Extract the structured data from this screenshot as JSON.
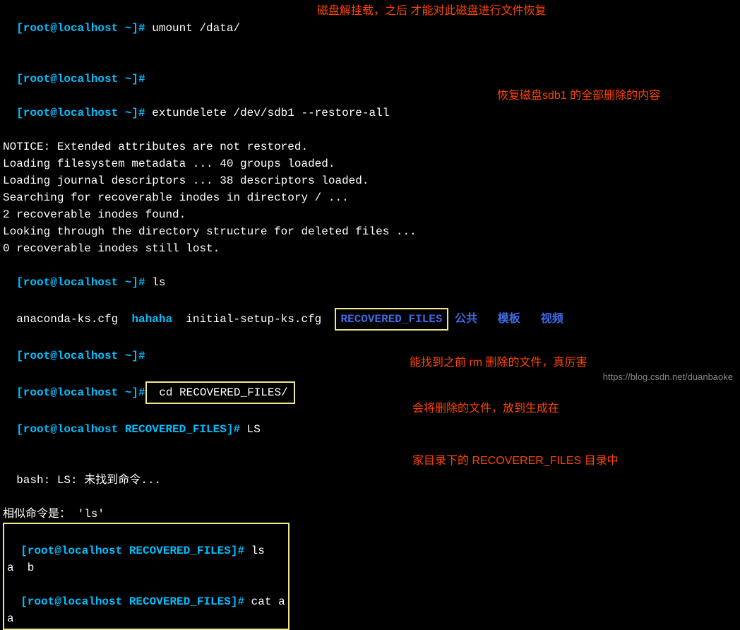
{
  "lines": {
    "l1": {
      "prompt": "[root@localhost ~]#",
      "cmd": " umount /data/"
    },
    "l2": {
      "prompt": "[root@localhost ~]#"
    },
    "l3": {
      "prompt": "[root@localhost ~]#",
      "cmd": " extundelete /dev/sdb1 --restore-all"
    },
    "l4": "NOTICE: Extended attributes are not restored.",
    "l5": "Loading filesystem metadata ... 40 groups loaded.",
    "l6": "Loading journal descriptors ... 38 descriptors loaded.",
    "l7": "Searching for recoverable inodes in directory / ...",
    "l8": "2 recoverable inodes found.",
    "l9": "Looking through the directory structure for deleted files ...",
    "l10": "0 recoverable inodes still lost.",
    "l11": {
      "prompt": "[root@localhost ~]#",
      "cmd": " ls"
    },
    "l12": {
      "f1": "anaconda-ks.cfg  ",
      "f2": "hahaha",
      "f3": "  initial-setup-ks.cfg  ",
      "f4": "RECOVERED_FILES",
      "f5": " 公共",
      "f6": "   模板",
      "f7": "   视频"
    },
    "l13": {
      "prompt": "[root@localhost ~]#"
    },
    "l14": {
      "prompt": "[root@localhost ~]#",
      "cmd": " cd RECOVERED_FILES/"
    },
    "l15": {
      "prompt": "[root@localhost RECOVERED_FILES]#",
      "cmd": " LS"
    },
    "l16": "bash: LS: 未找到命令...",
    "l17": "相似命令是： 'ls'",
    "l18": {
      "prompt": "[root@localhost RECOVERED_FILES]#",
      "cmd": " ls"
    },
    "l19": "a  b",
    "l20": {
      "prompt": "[root@localhost RECOVERED_FILES]#",
      "cmd": " cat a"
    },
    "l21": "a"
  },
  "annotations": {
    "a1": "磁盘解挂载，之后 才能对此磁盘进行文件恢复",
    "a2": "恢复磁盘sdb1 的全部删除的内容",
    "a3": "会将删除的文件，放到生成在",
    "a4": "家目录下的 RECOVERER_FILES 目录中",
    "a5": "能找到之前 rm 删除的文件，真厉害"
  },
  "watermark": "https://blog.csdn.net/duanbaoke"
}
